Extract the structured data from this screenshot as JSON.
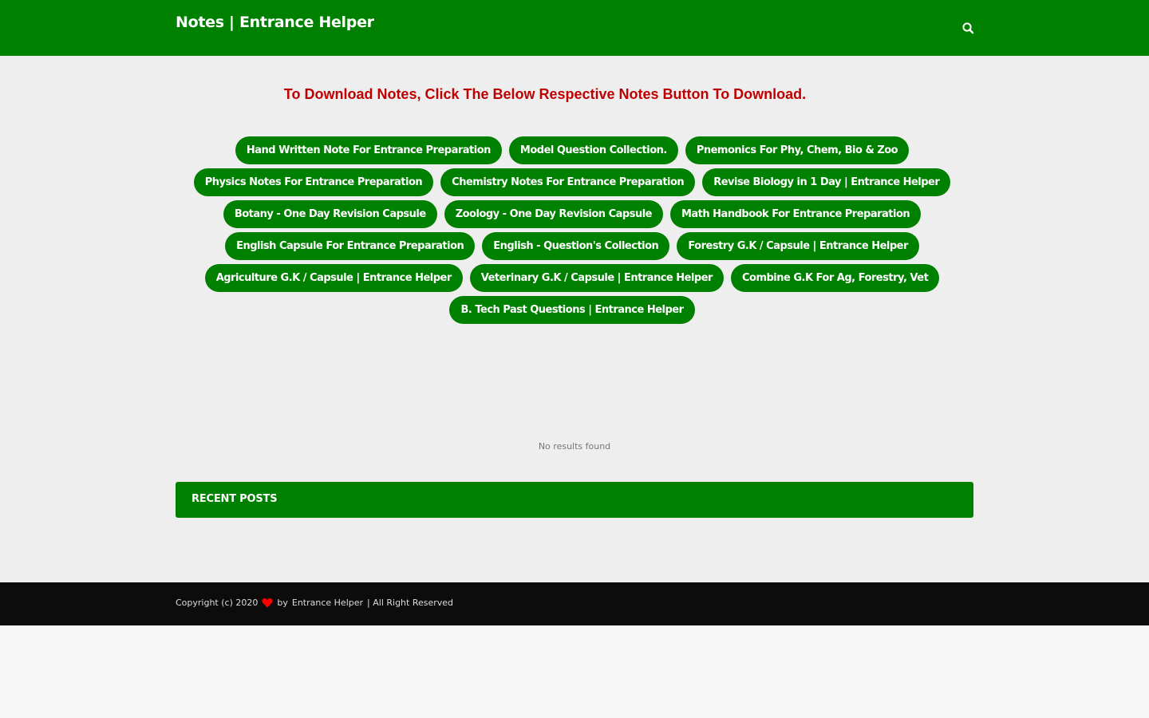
{
  "header": {
    "site_title": "Notes | Entrance Helper",
    "search_icon": "search-icon",
    "background_color": "#008000"
  },
  "main": {
    "notice": "To Download Notes, Click The Below Respective Notes Button To Download.",
    "notice_color": "#c00000",
    "note_buttons": [
      [
        "Hand Written Note For Entrance Preparation",
        "Model Question Collection.",
        "Pnemonics For Phy, Chem, Bio & Zoo"
      ],
      [
        "Physics Notes For Entrance Preparation",
        "Chemistry Notes For Entrance Preparation",
        "Revise Biology in 1 Day | Entrance Helper"
      ],
      [
        "Botany - One Day Revision Capsule",
        "Zoology - One Day Revision Capsule",
        "Math Handbook For Entrance Preparation"
      ],
      [
        "English Capsule For Entrance Preparation",
        "English - Question's Collection",
        "Forestry G.K / Capsule | Entrance Helper"
      ],
      [
        "Agriculture G.K / Capsule | Entrance Helper",
        "Veterinary G.K / Capsule | Entrance Helper",
        "Combine G.K For Ag, Forestry, Vet"
      ],
      [
        "B. Tech Past Questions | Entrance Helper"
      ]
    ],
    "no_results": "No results found",
    "recent_posts_title": "RECENT POSTS"
  },
  "footer": {
    "copyright_prefix": "Copyright (c) 2020",
    "heart_icon": "heart-icon",
    "heart_color": "#ff0000",
    "by_text": "by",
    "author": "Entrance Helper",
    "suffix": "| All Right Reserved"
  }
}
